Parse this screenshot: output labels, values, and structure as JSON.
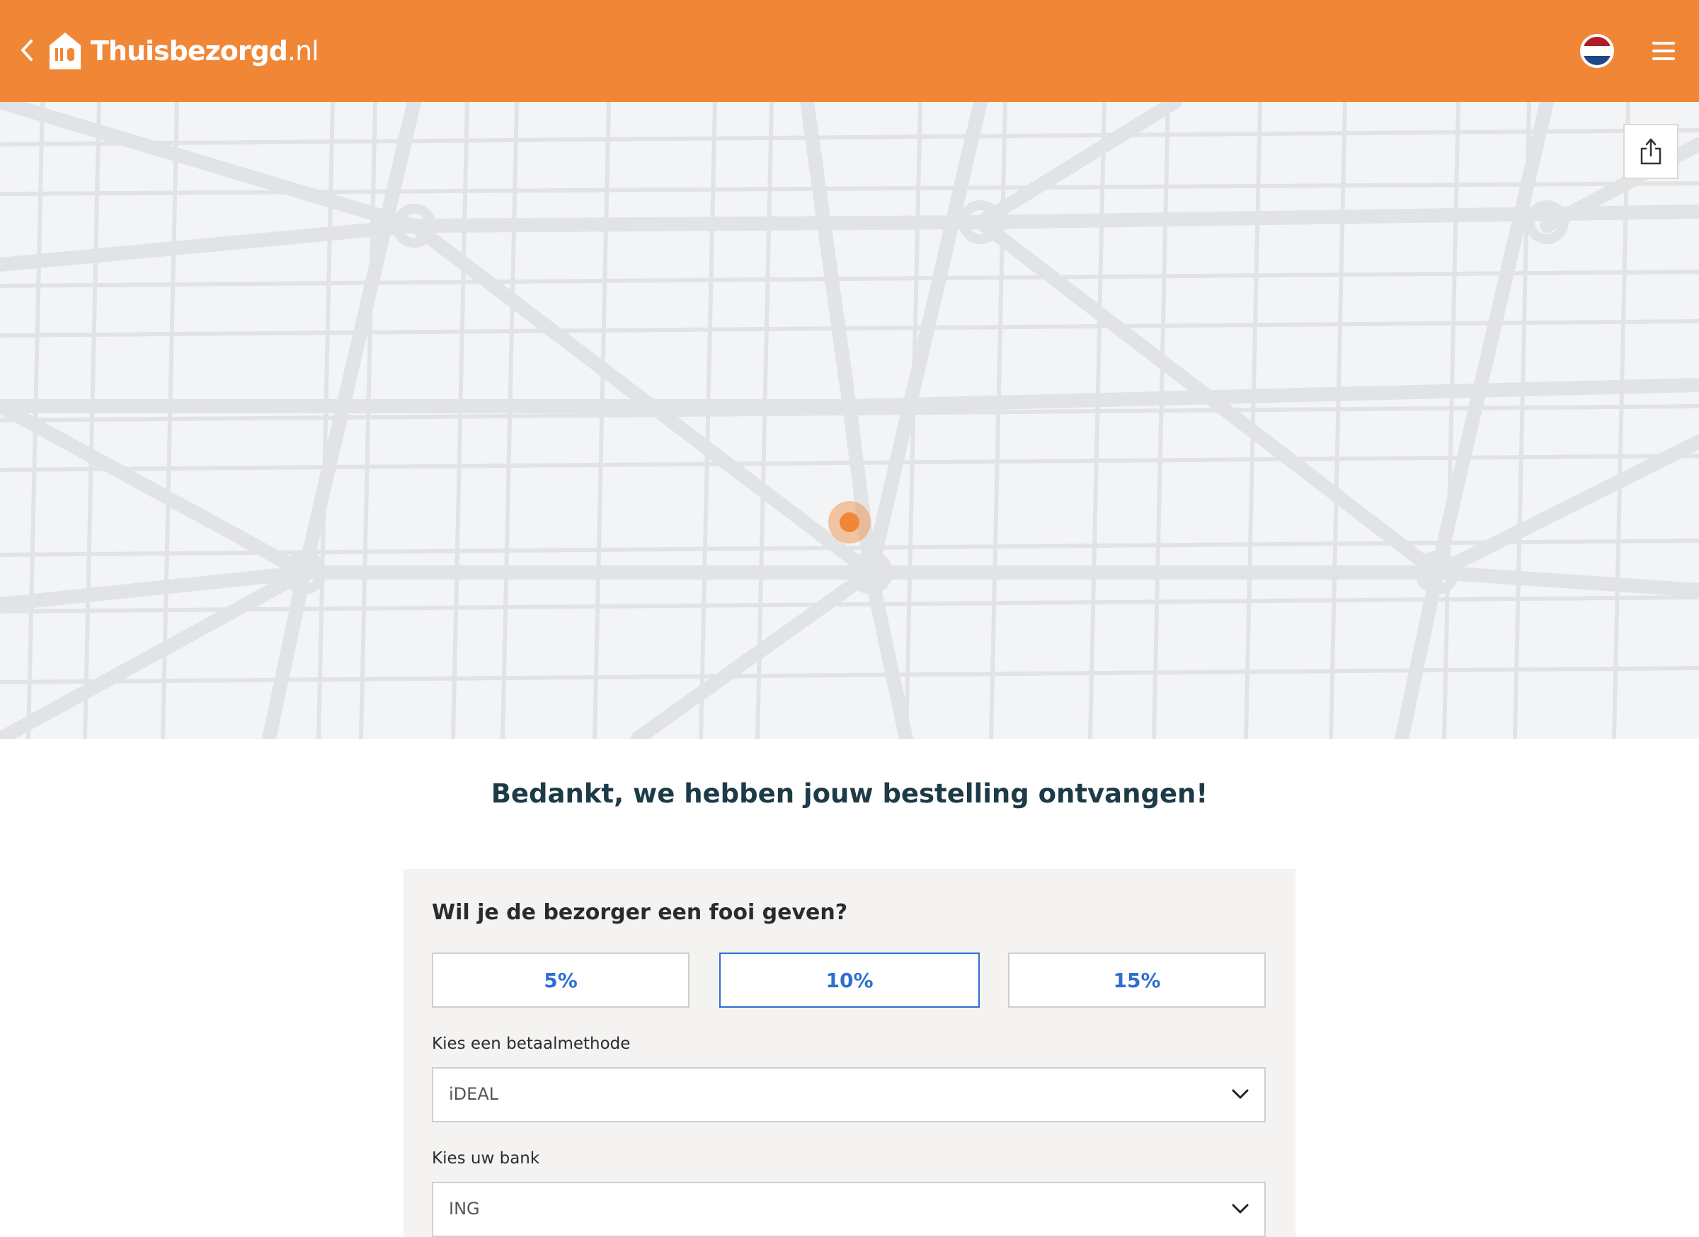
{
  "header": {
    "brand": "Thuisbezorgd",
    "brand_tld": ".nl",
    "colors": {
      "bar": "#f08737"
    },
    "icons": [
      "chevron-left-icon",
      "logo-house-icon",
      "netherlands-flag-icon",
      "hamburger-menu-icon"
    ]
  },
  "map": {
    "icons": [
      "share-icon",
      "location-pin-icon"
    ]
  },
  "confirmation": {
    "title": "Bedankt, we hebben jouw bestelling ontvangen!"
  },
  "tip": {
    "question": "Wil je de bezorger een fooi geven?",
    "options": [
      "5%",
      "10%",
      "15%"
    ],
    "selected": "10%"
  },
  "payment": {
    "method_label": "Kies een betaalmethode",
    "method_value": "iDEAL",
    "bank_label": "Kies uw bank",
    "bank_value": "ING"
  }
}
